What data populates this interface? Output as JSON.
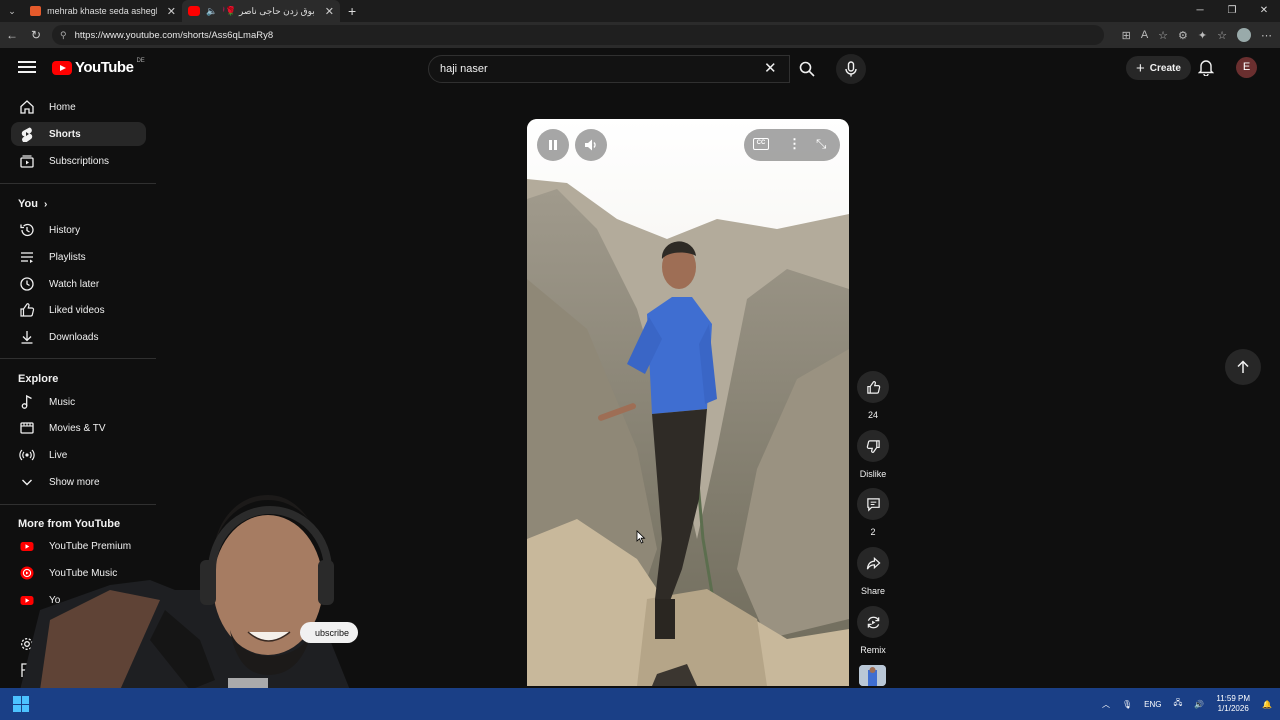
{
  "browser": {
    "tabs": [
      {
        "title": "mehrab khaste seda ashegh resul",
        "favicon_color": "#e55a2b",
        "active": false
      },
      {
        "title": "بوق زدن حاجی ناصر 🌹💗 - ...",
        "favicon_color": "#ff0000",
        "active": true
      }
    ],
    "new_tab_icon": "plus-icon",
    "url": "https://www.youtube.com/shorts/Ass6qLmaRy8"
  },
  "header": {
    "logo_text": "YouTube",
    "country_code": "DE",
    "search_value": "haji naser",
    "create_label": "Create",
    "avatar_letter": "E"
  },
  "sidebar": {
    "main": [
      {
        "label": "Home",
        "icon": "home-icon"
      },
      {
        "label": "Shorts",
        "icon": "shorts-icon",
        "active": true
      },
      {
        "label": "Subscriptions",
        "icon": "subscriptions-icon"
      }
    ],
    "you_heading": "You",
    "you": [
      {
        "label": "History",
        "icon": "history-icon"
      },
      {
        "label": "Playlists",
        "icon": "playlists-icon"
      },
      {
        "label": "Watch later",
        "icon": "clock-icon"
      },
      {
        "label": "Liked videos",
        "icon": "thumbs-up-icon"
      },
      {
        "label": "Downloads",
        "icon": "download-icon"
      }
    ],
    "explore_heading": "Explore",
    "explore": [
      {
        "label": "Music",
        "icon": "music-note-icon"
      },
      {
        "label": "Movies & TV",
        "icon": "film-icon"
      },
      {
        "label": "Live",
        "icon": "live-icon"
      },
      {
        "label": "Show more",
        "icon": "chevron-down-icon"
      }
    ],
    "more_heading": "More from YouTube",
    "more": [
      {
        "label": "YouTube Premium",
        "icon": "youtube-premium-icon"
      },
      {
        "label": "YouTube Music",
        "icon": "youtube-music-icon"
      },
      {
        "label": "Yo",
        "icon": "youtube-kids-icon"
      }
    ]
  },
  "actions": {
    "likes": "24",
    "dislike_label": "Dislike",
    "comments": "2",
    "share_label": "Share",
    "remix_label": "Remix"
  },
  "overlay": {
    "subscribe_fragment": "ubscribe"
  },
  "taskbar": {
    "language": "ENG",
    "time": "11:59 PM",
    "date": "1/1/2026"
  },
  "colors": {
    "background": "#0f0f0f",
    "surface": "#272727",
    "youtube_red": "#ff0000",
    "taskbar": "#1a3f86"
  }
}
